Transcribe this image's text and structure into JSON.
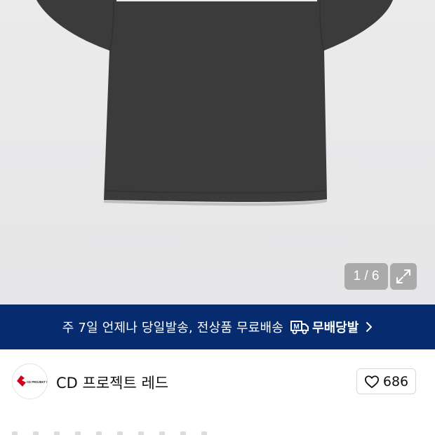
{
  "gallery": {
    "counter": "1 / 6",
    "expand_icon": "expand-icon"
  },
  "promo": {
    "text": "주 7일 언제나 당일발송, 전상품 무료배송",
    "badge_label": "무배당발",
    "badge_icon": "delivery-truck-icon",
    "arrow_icon": "chevron-right-icon"
  },
  "brand": {
    "name": "CD 프로젝트 레드",
    "logo_text": "CD PROJEKT RED",
    "logo_color": "#d0021b"
  },
  "like": {
    "icon": "heart-icon",
    "count": "686"
  },
  "colors": {
    "banner_bg": "#062b6e",
    "shirt": "#3b3b3b"
  }
}
